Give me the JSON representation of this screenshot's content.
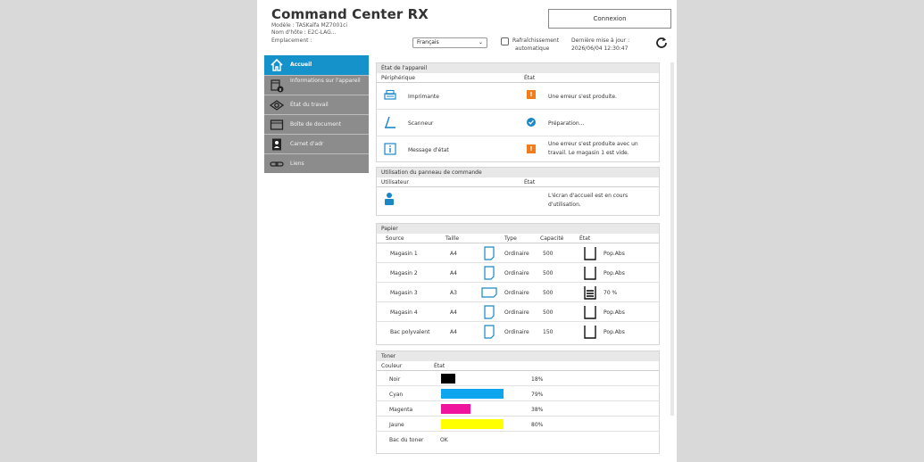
{
  "header": {
    "title": "Command Center RX",
    "model": "Modèle : TASKalfa MZ7001ci",
    "hostname": "Nom d'hôte : E2C-LAG...",
    "location": "Emplacement :",
    "login_button": "Connexion",
    "language": "Français",
    "auto_refresh_line1": "Rafraîchissement",
    "auto_refresh_line2": "automatique",
    "last_update_line1": "Dernière mise à jour :",
    "last_update_line2": "2026/06/04 12:30:47"
  },
  "sidebar": {
    "items": [
      {
        "label": "Accueil",
        "icon": "home-icon"
      },
      {
        "label": "Informations sur l'appareil",
        "icon": "device-info-icon"
      },
      {
        "label": "État du travail",
        "icon": "job-status-icon"
      },
      {
        "label": "Boîte de document",
        "icon": "document-box-icon"
      },
      {
        "label": "Carnet d'adr",
        "icon": "address-book-icon"
      },
      {
        "label": "Liens",
        "icon": "link-icon"
      }
    ]
  },
  "device_status": {
    "title": "État de l'appareil",
    "col_device": "Périphérique",
    "col_status": "État",
    "rows": [
      {
        "device": "Imprimante",
        "status": "Une erreur s'est produite.",
        "level": "warning"
      },
      {
        "device": "Scanneur",
        "status": "Préparation...",
        "level": "ok"
      },
      {
        "device": "Message d'état",
        "status_line1": "Une erreur s'est produite avec un",
        "status_line2": "travail. Le magasin 1 est vide.",
        "level": "warning"
      }
    ]
  },
  "panel_usage": {
    "title": "Utilisation du panneau de commande",
    "col_user": "Utilisateur",
    "col_status": "État",
    "status_line1": "L'écran d'accueil est en cours",
    "status_line2": "d'utilisation."
  },
  "paper": {
    "title": "Papier",
    "col_source": "Source",
    "col_size": "Taille",
    "col_type": "Type",
    "col_capacity": "Capacité",
    "col_status": "État",
    "rows": [
      {
        "source": "Magasin 1",
        "size": "A4",
        "type": "Ordinaire",
        "capacity": "500",
        "status": "Pop.Abs",
        "level": 0
      },
      {
        "source": "Magasin 2",
        "size": "A4",
        "type": "Ordinaire",
        "capacity": "500",
        "status": "Pop.Abs",
        "level": 0
      },
      {
        "source": "Magasin 3",
        "size": "A3",
        "type": "Ordinaire",
        "capacity": "500",
        "status": "70 %",
        "level": 0.7
      },
      {
        "source": "Magasin 4",
        "size": "A4",
        "type": "Ordinaire",
        "capacity": "500",
        "status": "Pop.Abs",
        "level": 0
      },
      {
        "source": "Bac polyvalent",
        "size": "A4",
        "type": "Ordinaire",
        "capacity": "150",
        "status": "Pop.Abs",
        "level": 0
      }
    ]
  },
  "toner": {
    "title": "Toner",
    "col_color": "Couleur",
    "col_status": "État",
    "rows": [
      {
        "color": "Noir",
        "percent": "18%",
        "level": 0.18,
        "hex": "#000000"
      },
      {
        "color": "Cyan",
        "percent": "79%",
        "level": 0.79,
        "hex": "#0ea5ef"
      },
      {
        "color": "Magenta",
        "percent": "38%",
        "level": 0.38,
        "hex": "#f0139e"
      },
      {
        "color": "Jaune",
        "percent": "80%",
        "level": 0.8,
        "hex": "#ffff00"
      }
    ],
    "waste_label": "Bac du toner",
    "waste_status": "OK"
  },
  "colors": {
    "accent": "#1592c9",
    "warning": "#f07d1a",
    "nav_bg": "#8c8c8c"
  }
}
